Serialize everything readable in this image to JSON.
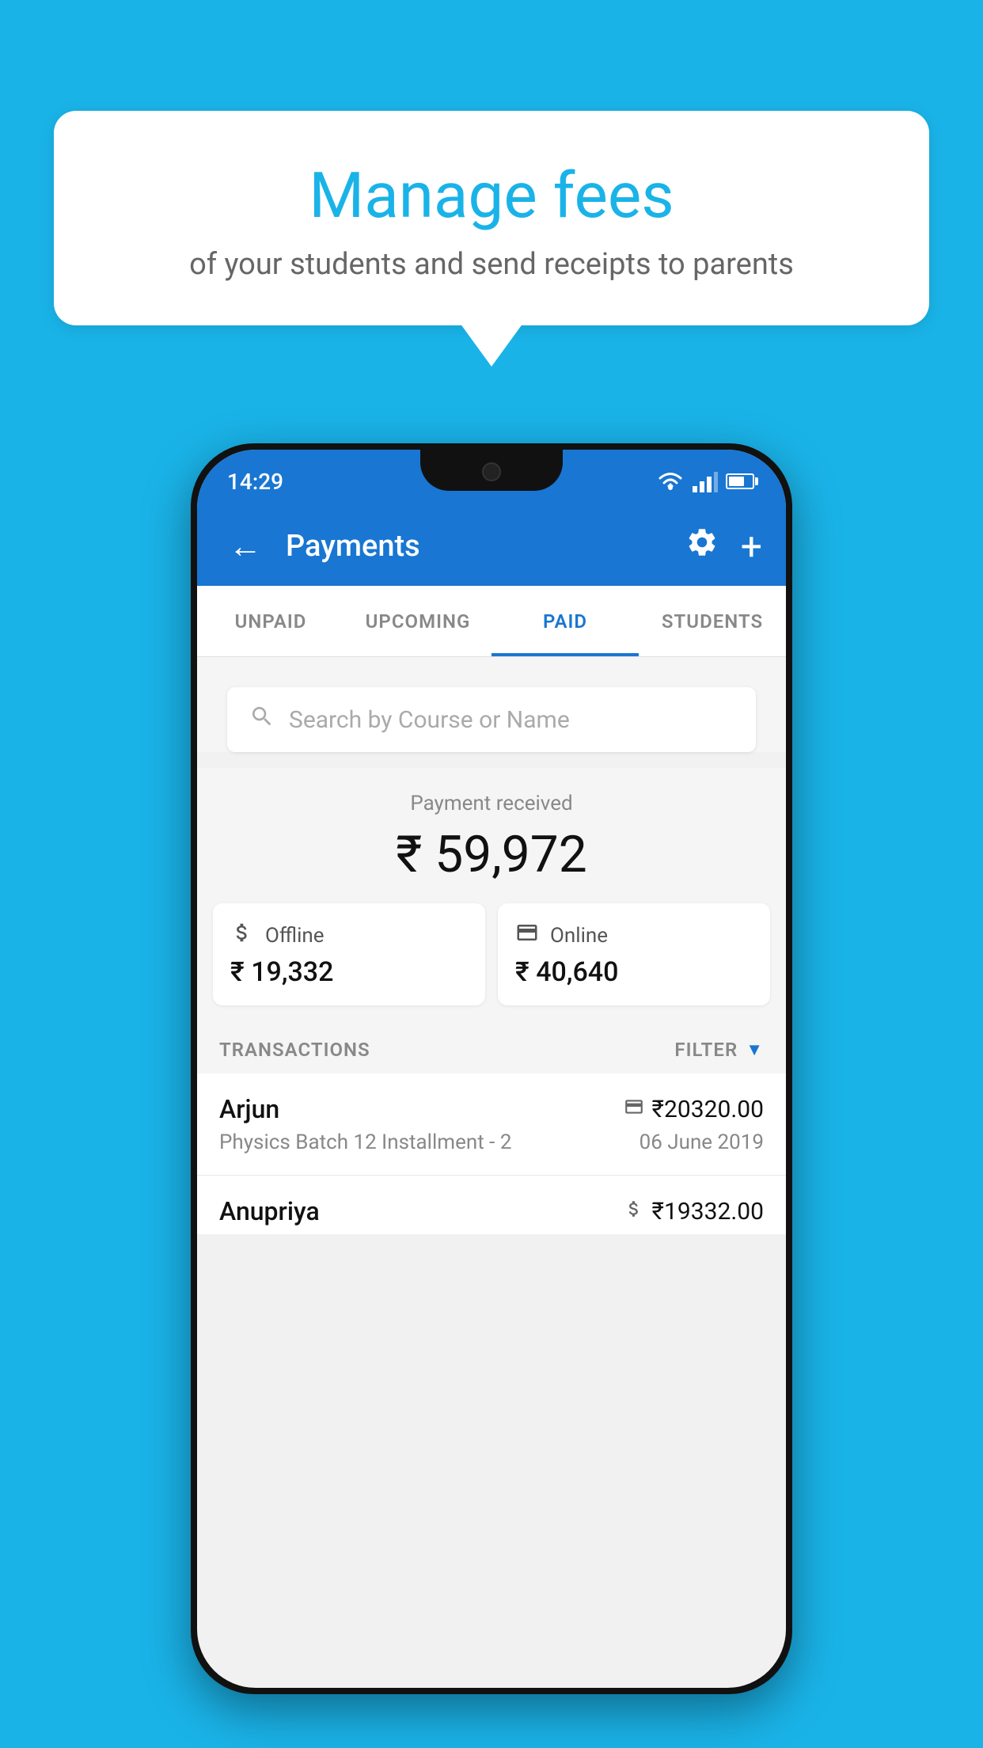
{
  "background_color": "#1ab3e8",
  "bubble": {
    "title": "Manage fees",
    "subtitle": "of your students and send receipts to parents"
  },
  "status_bar": {
    "time": "14:29",
    "wifi": true,
    "signal": true,
    "battery": true
  },
  "app_bar": {
    "title": "Payments",
    "back_label": "←",
    "gear_label": "⚙",
    "plus_label": "+"
  },
  "tabs": [
    {
      "id": "unpaid",
      "label": "UNPAID",
      "active": false
    },
    {
      "id": "upcoming",
      "label": "UPCOMING",
      "active": false
    },
    {
      "id": "paid",
      "label": "PAID",
      "active": true
    },
    {
      "id": "students",
      "label": "STUDENTS",
      "active": false
    }
  ],
  "search": {
    "placeholder": "Search by Course or Name"
  },
  "payment_summary": {
    "label": "Payment received",
    "amount": "₹ 59,972"
  },
  "payment_cards": [
    {
      "type": "Offline",
      "amount": "₹ 19,332",
      "icon": "💳"
    },
    {
      "type": "Online",
      "amount": "₹ 40,640",
      "icon": "💳"
    }
  ],
  "transactions_header": {
    "label": "TRANSACTIONS",
    "filter_label": "FILTER"
  },
  "transactions": [
    {
      "name": "Arjun",
      "amount": "₹20320.00",
      "course": "Physics Batch 12 Installment - 2",
      "date": "06 June 2019",
      "payment_type": "online"
    },
    {
      "name": "Anupriya",
      "amount": "₹19332.00",
      "course": "",
      "date": "",
      "payment_type": "offline"
    }
  ]
}
